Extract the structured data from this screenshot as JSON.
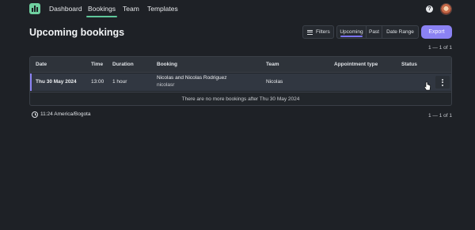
{
  "nav": {
    "items": [
      {
        "label": "Dashboard",
        "active": false
      },
      {
        "label": "Bookings",
        "active": true
      },
      {
        "label": "Team",
        "active": false
      },
      {
        "label": "Templates",
        "active": false
      }
    ],
    "help_icon": "help-icon",
    "avatar": "user-avatar"
  },
  "header": {
    "title": "Upcoming bookings",
    "filters_label": "Filters",
    "segments": [
      "Upcoming",
      "Past",
      "Date Range"
    ],
    "active_segment": "Upcoming",
    "export_label": "Export"
  },
  "pager_top": "1 — 1 of 1",
  "table": {
    "columns": [
      "Date",
      "Time",
      "Duration",
      "Booking",
      "Team",
      "Appointment type",
      "Status"
    ],
    "rows": [
      {
        "date": "Thu 30 May 2024",
        "time": "13:00",
        "duration": "1 hour",
        "booking_title": "Nicolas and Nicolas Rodriguez",
        "booking_user": "nicolasr",
        "team": "Nicolas",
        "appointment_type": "",
        "status": ""
      }
    ],
    "footer": "There are no more bookings after Thu 30 May 2024"
  },
  "timezone": "11:24 America/Bogota",
  "pager_bottom": "1 — 1 of 1",
  "colors": {
    "background": "#1e2126",
    "accent": "#8b82f3",
    "nav_active": "#5fc79a"
  }
}
